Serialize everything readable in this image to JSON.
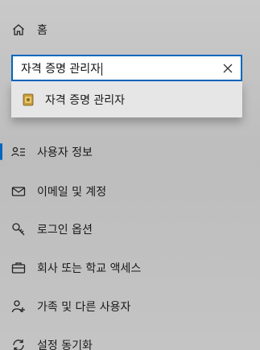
{
  "nav": {
    "home_label": "홈",
    "items": [
      {
        "label": "사용자 정보",
        "icon": "person-list-icon"
      },
      {
        "label": "이메일 및 계정",
        "icon": "mail-icon"
      },
      {
        "label": "로그인 옵션",
        "icon": "key-icon"
      },
      {
        "label": "회사 또는 학교 액세스",
        "icon": "briefcase-icon"
      },
      {
        "label": "가족 및 다른 사용자",
        "icon": "person-add-icon"
      },
      {
        "label": "설정 동기화",
        "icon": "sync-icon"
      }
    ]
  },
  "search": {
    "value": "자격 증명 관리자",
    "suggestion": "자격 증명 관리자"
  },
  "colors": {
    "accent": "#0067c0",
    "background": "#c4c4c4",
    "dropdown": "#e6e6e6"
  }
}
